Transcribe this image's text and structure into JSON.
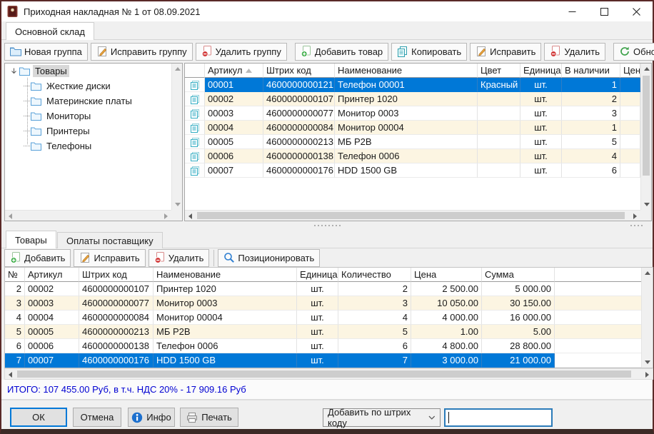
{
  "window": {
    "title": "Приходная накладная № 1 от 08.09.2021"
  },
  "tabs": {
    "warehouse": "Основной склад"
  },
  "toolbar_top": {
    "new_group": "Новая группа",
    "edit_group": "Исправить группу",
    "delete_group": "Удалить группу",
    "add_item": "Добавить товар",
    "copy": "Копировать",
    "edit": "Исправить",
    "delete": "Удалить",
    "refresh": "Обновить"
  },
  "tree": {
    "root": "Товары",
    "children": [
      "Жесткие диски",
      "Материнские платы",
      "Мониторы",
      "Принтеры",
      "Телефоны"
    ]
  },
  "products_table": {
    "headers": {
      "artikul": "Артикул",
      "barcode": "Штрих код",
      "name": "Наименование",
      "color": "Цвет",
      "unit": "Единица",
      "stock": "В наличии",
      "price": "Цена"
    },
    "rows": [
      {
        "artikul": "00001",
        "barcode": "4600000000121",
        "name": "Телефон 00001",
        "color": "Красный",
        "unit": "шт.",
        "stock": "1"
      },
      {
        "artikul": "00002",
        "barcode": "4600000000107",
        "name": "Принтер 1020",
        "color": "",
        "unit": "шт.",
        "stock": "2"
      },
      {
        "artikul": "00003",
        "barcode": "4600000000077",
        "name": "Монитор 0003",
        "color": "",
        "unit": "шт.",
        "stock": "3"
      },
      {
        "artikul": "00004",
        "barcode": "4600000000084",
        "name": "Монитор 00004",
        "color": "",
        "unit": "шт.",
        "stock": "1"
      },
      {
        "artikul": "00005",
        "barcode": "4600000000213",
        "name": "МБ P2B",
        "color": "",
        "unit": "шт.",
        "stock": "5"
      },
      {
        "artikul": "00006",
        "barcode": "4600000000138",
        "name": "Телефон 0006",
        "color": "",
        "unit": "шт.",
        "stock": "4"
      },
      {
        "artikul": "00007",
        "barcode": "4600000000176",
        "name": "HDD 1500 GB",
        "color": "",
        "unit": "шт.",
        "stock": "6"
      }
    ]
  },
  "bottom_tabs": {
    "items": "Товары",
    "payments": "Оплаты поставщику"
  },
  "toolbar_bottom": {
    "add": "Добавить",
    "edit": "Исправить",
    "delete": "Удалить",
    "position": "Позиционировать"
  },
  "items_table": {
    "headers": {
      "num": "№",
      "artikul": "Артикул",
      "barcode": "Штрих код",
      "name": "Наименование",
      "unit": "Единица",
      "qty": "Количество",
      "price": "Цена",
      "sum": "Сумма"
    },
    "rows": [
      {
        "num": "2",
        "artikul": "00002",
        "barcode": "4600000000107",
        "name": "Принтер 1020",
        "unit": "шт.",
        "qty": "2",
        "price": "2 500.00",
        "sum": "5 000.00"
      },
      {
        "num": "3",
        "artikul": "00003",
        "barcode": "4600000000077",
        "name": "Монитор 0003",
        "unit": "шт.",
        "qty": "3",
        "price": "10 050.00",
        "sum": "30 150.00"
      },
      {
        "num": "4",
        "artikul": "00004",
        "barcode": "4600000000084",
        "name": "Монитор 00004",
        "unit": "шт.",
        "qty": "4",
        "price": "4 000.00",
        "sum": "16 000.00"
      },
      {
        "num": "5",
        "artikul": "00005",
        "barcode": "4600000000213",
        "name": "МБ P2B",
        "unit": "шт.",
        "qty": "5",
        "price": "1.00",
        "sum": "5.00"
      },
      {
        "num": "6",
        "artikul": "00006",
        "barcode": "4600000000138",
        "name": "Телефон 0006",
        "unit": "шт.",
        "qty": "6",
        "price": "4 800.00",
        "sum": "28 800.00"
      },
      {
        "num": "7",
        "artikul": "00007",
        "barcode": "4600000000176",
        "name": "HDD 1500 GB",
        "unit": "шт.",
        "qty": "7",
        "price": "3 000.00",
        "sum": "21 000.00"
      }
    ]
  },
  "status": {
    "totals": "ИТОГО: 107 455.00 Руб, в т.ч. НДС 20% - 17 909.16 Руб"
  },
  "footer": {
    "ok": "ОК",
    "cancel": "Отмена",
    "info": "Инфо",
    "print": "Печать",
    "combo_value": "Добавить по штрих коду",
    "barcode_value": ""
  },
  "colors": {
    "selection": "#0078d7",
    "alt_row": "#fcf5e2",
    "status_text": "#0000d2",
    "accent": "#2b7bb9"
  }
}
